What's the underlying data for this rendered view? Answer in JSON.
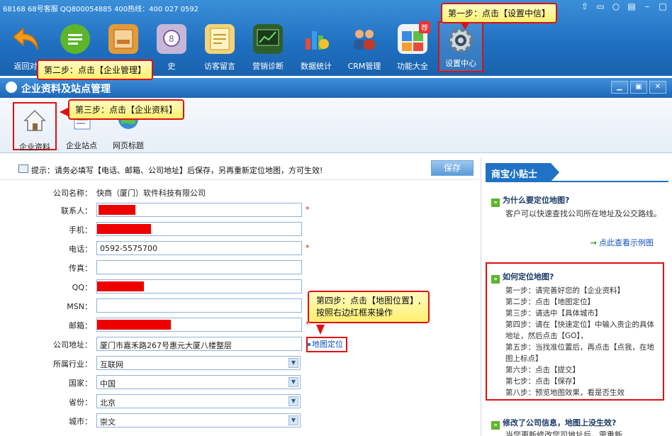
{
  "app": {
    "title_line": "68168 68号客服 QQ800054885   400热线：400 027 0592",
    "toolbar": [
      {
        "label": "返回对"
      },
      {
        "label": ""
      },
      {
        "label": ""
      },
      {
        "label": "史"
      },
      {
        "label": "访客留言"
      },
      {
        "label": "营销诊断"
      },
      {
        "label": "数据统计"
      },
      {
        "label": "CRM管理"
      },
      {
        "label": "功能大全"
      },
      {
        "label": "设置中心"
      }
    ],
    "icon_badge": "荐"
  },
  "window": {
    "title": "企业资料及站点管理"
  },
  "subtoolbar": [
    {
      "label": "企业资料"
    },
    {
      "label": "企业站点"
    },
    {
      "label": "网页标题"
    }
  ],
  "hint": "提示：请务必填写【电话、邮箱、公司地址】后保存，另再重新定位地图，方可生效!",
  "save_label": "保存",
  "form": {
    "company_label": "公司名称：",
    "company_value": "快商（厦门）软件科技有限公司",
    "contact_label": "联系人：",
    "mobile_label": "手机：",
    "phone_label": "电话：",
    "phone_value": "0592-5575700",
    "fax_label": "传真：",
    "qq_label": "QQ：",
    "msn_label": "MSN：",
    "email_label": "邮箱：",
    "address_label": "公司地址：",
    "address_value": "厦门市嘉禾路267号惠元大厦八楼整层",
    "map_link": "地图定位",
    "industry_label": "所属行业：",
    "industry_value": "互联网",
    "country_label": "国家：",
    "country_value": "中国",
    "province_label": "省份：",
    "province_value": "北京",
    "city_label": "城市：",
    "city_value": "崇文",
    "required_mark": "*"
  },
  "tips": {
    "header": "商宝小贴士",
    "q1": "为什么要定位地图?",
    "a1": "客户可以快速查找公司所在地址及公交路线。",
    "example_link": "点此查看示例图",
    "q2": "如何定位地图?",
    "steps": [
      "第一步：请完善好您的【企业资料】",
      "第二步：点击【地图定位】",
      "第三步：请选中【具体城市】",
      "第四步：请在【快速定位】中输入贵企的具体地址，然后点击【GO】，",
      "第五步：当找准位置后，再点击【点我，在地图上标点】",
      "第六步：点击【提交】",
      "第七步：点击【保存】",
      "第八步：预览地图效果，看是否生效"
    ],
    "q3": "修改了公司信息，地图上没生效?",
    "a3": "当您更新修改您司地址后，需重新"
  },
  "callouts": {
    "step1": "第一步：点击【设置中信】",
    "step2": "第二步：点击【企业管理】",
    "step3": "第三步：点击【企业资料】",
    "step4_line1": "第四步：点击【地图位置】,",
    "step4_line2": "按照右边红框来操作"
  },
  "colors": {
    "toolbar_blue": "#1f6fc0",
    "highlight_red": "#e01010",
    "callout_yellow": "#fff070",
    "link_blue": "#1050c0",
    "tip_green": "#5cb52b"
  }
}
